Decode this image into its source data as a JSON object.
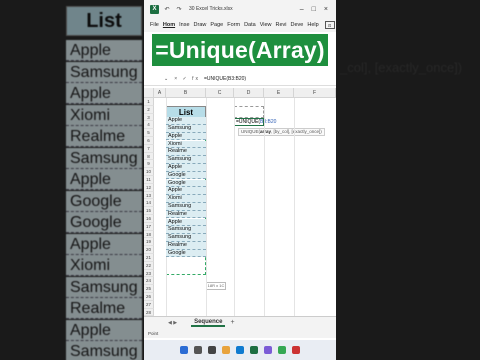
{
  "window": {
    "logo": "X",
    "title": "30 Excel Tricks.xlsx",
    "controls": [
      "–",
      "□",
      "×"
    ]
  },
  "menu": {
    "items": [
      "File",
      "Hom",
      "Inse",
      "Draw",
      "Page",
      "Form",
      "Data",
      "View",
      "Revi",
      "Deve",
      "Help"
    ],
    "active_index": 1
  },
  "banner": {
    "text": "=Unique(Array)"
  },
  "formula_bar": {
    "formula": "=UNIQUE(B3:B20)",
    "icons": "× ✓ fx"
  },
  "grid": {
    "columns": [
      "A",
      "B",
      "C",
      "D",
      "E",
      "F"
    ],
    "rows": [
      "1",
      "2",
      "3",
      "4",
      "5",
      "6",
      "7",
      "8",
      "9",
      "10",
      "11",
      "12",
      "13",
      "14",
      "15",
      "16",
      "17",
      "18",
      "19",
      "20",
      "21",
      "22",
      "23",
      "24",
      "25",
      "26",
      "27",
      "28"
    ],
    "list_header": "List",
    "list_values": [
      "Apple",
      "Samsung",
      "Apple",
      "Xiomi",
      "Realme",
      "Samsung",
      "Apple",
      "Google",
      "Google",
      "Apple",
      "Xiomi",
      "Samsung",
      "Realme",
      "Apple",
      "Samsung",
      "Samsung",
      "Realme",
      "Google"
    ],
    "active_cell_prefix": "=UNIQUE(",
    "active_cell_ref": "B3:B20",
    "tooltip_fn": "UNIQUE(",
    "tooltip_arg": "array",
    "tooltip_rest": ", [by_col], [exactly_once])",
    "quick_analysis": "18R x 1C"
  },
  "sheets": {
    "nav": "◀ ▶",
    "active": "Sequence",
    "add": "+"
  },
  "status": {
    "text": "Point"
  },
  "background": {
    "right_text": "_col], [exactly_once])"
  },
  "colors": {
    "excel_green": "#1e8f3e",
    "header_fill": "#b7dde8",
    "cell_fill": "#dcedf2"
  }
}
